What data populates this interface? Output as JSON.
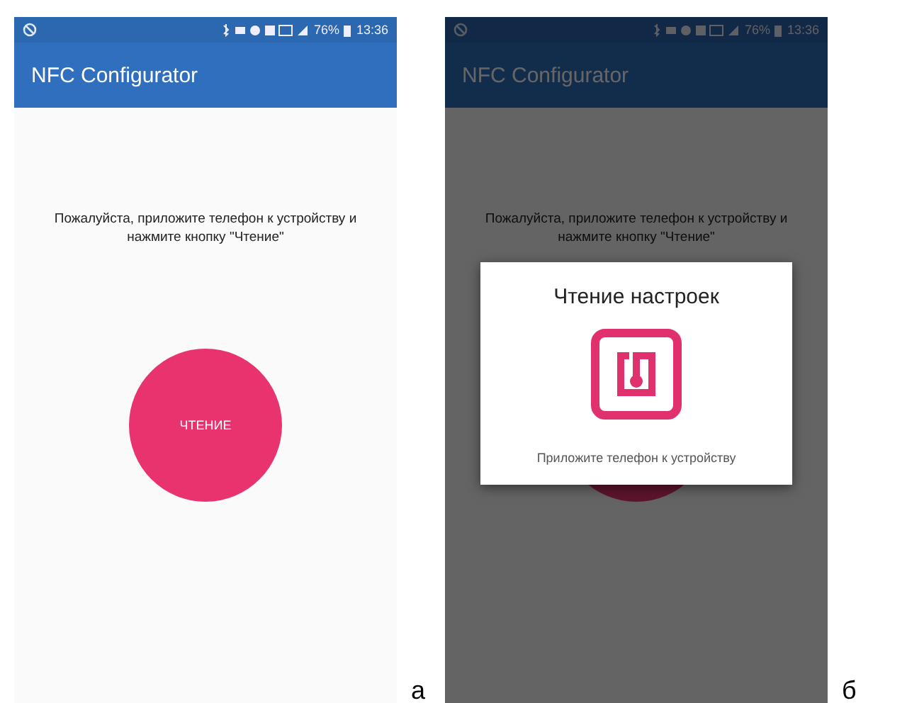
{
  "panels": [
    {
      "label": "а",
      "status_bar": {
        "battery": "76%",
        "time": "13:36"
      },
      "app_bar": {
        "title": "NFC Configurator"
      },
      "instruction": "Пожалуйста, приложите телефон к устройству и нажмите кнопку \"Чтение\"",
      "read_button": {
        "label": "ЧТЕНИЕ"
      }
    },
    {
      "label": "б",
      "status_bar": {
        "battery": "76%",
        "time": "13:36"
      },
      "app_bar": {
        "title": "NFC Configurator"
      },
      "instruction": "Пожалуйста, приложите телефон к устройству и нажмите кнопку \"Чтение\"",
      "dialog": {
        "title": "Чтение настроек",
        "message": "Приложите телефон к устройству"
      }
    }
  ]
}
